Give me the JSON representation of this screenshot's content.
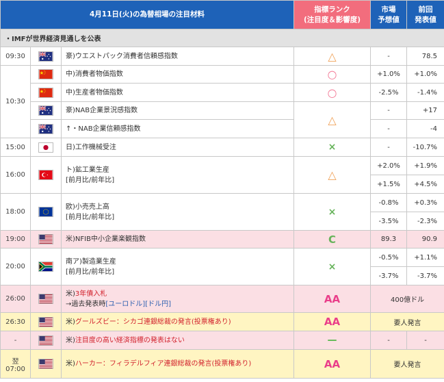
{
  "header": {
    "title": "4月11日(火)の為替相場の注目材料",
    "rank_label_1": "指標ランク",
    "rank_label_2": "(注目度＆影響度)",
    "forecast_label_1": "市場",
    "forecast_label_2": "予想値",
    "previous_label_1": "前回",
    "previous_label_2": "発表値"
  },
  "note": "・IMFが世界経済見通しを公表",
  "rows": [
    {
      "time": "09:30",
      "country": "au",
      "name": "豪)ウエストパック消費者信頼感指数",
      "rank": "△",
      "forecast": "-",
      "previous": "78.5"
    },
    {
      "time": "10:30",
      "country": "cn",
      "name": "中)消費者物価指数",
      "rank": "○",
      "forecast": "+1.0%",
      "previous": "+1.0%"
    },
    {
      "country": "cn",
      "name": "中)生産者物価指数",
      "rank": "○",
      "forecast": "-2.5%",
      "previous": "-1.4%"
    },
    {
      "country": "au",
      "name": "豪)NAB企業景況感指数",
      "rank": "△",
      "forecast": "-",
      "previous": "+17"
    },
    {
      "country": "au",
      "name": "↑・NAB企業信頼感指数",
      "forecast": "-",
      "previous": "-4"
    },
    {
      "time": "15:00",
      "country": "jp",
      "name": "日)工作機械受注",
      "rank": "×",
      "forecast": "-",
      "previous": "-10.7%"
    },
    {
      "time": "16:00",
      "country": "tr",
      "name": "ト)鉱工業生産",
      "sub": "[前月比/前年比]",
      "rank": "△",
      "forecast": "+2.0%",
      "previous": "+1.9%",
      "forecast2": "+1.5%",
      "previous2": "+4.5%"
    },
    {
      "time": "18:00",
      "country": "eu",
      "name": "欧)小売売上高",
      "sub": "[前月比/前年比]",
      "rank": "×",
      "forecast": "-0.8%",
      "previous": "+0.3%",
      "forecast2": "-3.5%",
      "previous2": "-2.3%"
    },
    {
      "time": "19:00",
      "country": "us",
      "name": "米)NFIB中小企業楽観指数",
      "rank": "C",
      "forecast": "89.3",
      "previous": "90.9"
    },
    {
      "time": "20:00",
      "country": "za",
      "name": "南ア)製造業生産",
      "sub": "[前月比/前年比]",
      "rank": "×",
      "forecast": "-0.5%",
      "previous": "+1.1%",
      "forecast2": "-3.7%",
      "previous2": "-3.7%"
    },
    {
      "time": "26:00",
      "country": "us",
      "name_prefix": "米)",
      "name_red": "3年債入札",
      "sub_prefix": "→過去発表時",
      "link1": "[ユーロドル]",
      "link2": "[ドル円]",
      "rank": "AA",
      "merged": "400億ドル"
    },
    {
      "time": "26:30",
      "country": "us",
      "name_prefix": "米)",
      "name_red": "グールズビー：シカゴ連銀総裁の発言(投票権あり)",
      "rank": "AA",
      "merged": "要人発言"
    },
    {
      "time": "-",
      "country": "us",
      "name_prefix": "米)",
      "name_red": "注目度の高い経済指標の発表はない",
      "rank": "—",
      "forecast": "-",
      "previous": "-"
    },
    {
      "time_1": "翌",
      "time_2": "07:00",
      "country": "us",
      "name_prefix": "米)",
      "name_red": "ハーカー：フィラデルフィア連銀総裁の発言(投票権あり)",
      "rank": "AA",
      "merged": "要人発言"
    }
  ],
  "colors": {
    "header_blue": "#1e62b8",
    "header_pink": "#f26d7d",
    "rank_triangle": "#f0a35a",
    "rank_circle": "#f37895",
    "rank_cross": "#66b35a",
    "rank_aa": "#ea3f8a",
    "row_pink": "#fbdfe4",
    "row_yellow": "#fff5c2",
    "name_red": "#d2222d"
  },
  "icons": {
    "au": "australia-flag-icon",
    "cn": "china-flag-icon",
    "jp": "japan-flag-icon",
    "tr": "turkey-flag-icon",
    "eu": "eu-flag-icon",
    "us": "us-flag-icon",
    "za": "south-africa-flag-icon"
  }
}
